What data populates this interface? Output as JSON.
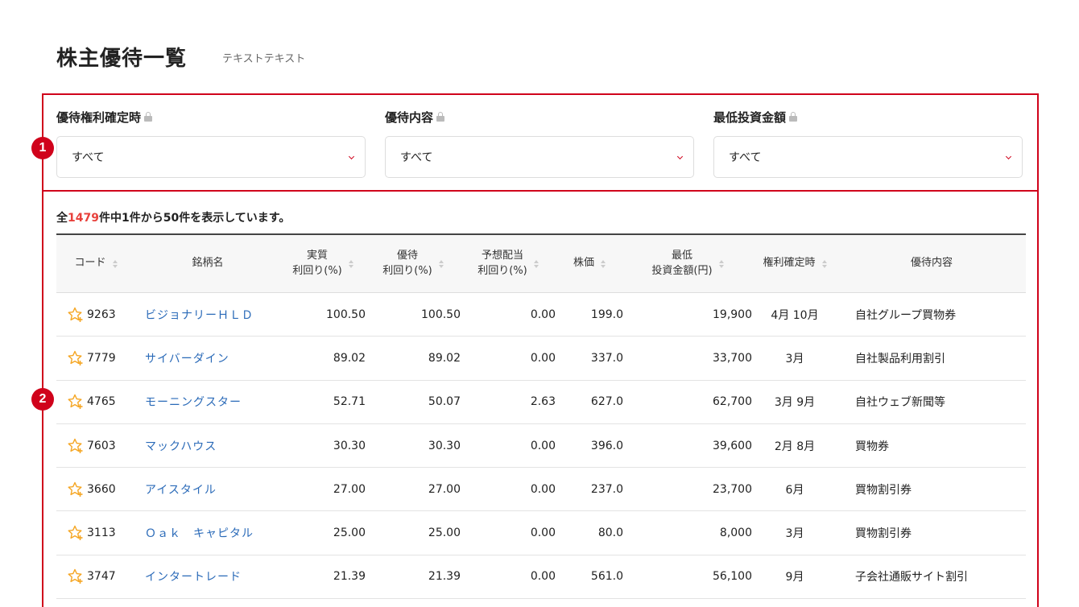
{
  "header": {
    "title": "株主優待一覧",
    "subtitle": "テキストテキスト"
  },
  "badges": [
    "1",
    "2"
  ],
  "filters": [
    {
      "label": "優待権利確定時",
      "value": "すべて"
    },
    {
      "label": "優待内容",
      "value": "すべて"
    },
    {
      "label": "最低投資金額",
      "value": "すべて"
    }
  ],
  "result": {
    "prefix": "全",
    "total": "1479",
    "suffix": "件中1件から50件を表示しています。"
  },
  "table": {
    "headers": [
      {
        "line1": "コード",
        "line2": ""
      },
      {
        "line1": "銘柄名",
        "line2": ""
      },
      {
        "line1": "実質",
        "line2": "利回り(%)"
      },
      {
        "line1": "優待",
        "line2": "利回り(%)"
      },
      {
        "line1": "予想配当",
        "line2": "利回り(%)"
      },
      {
        "line1": "株価",
        "line2": ""
      },
      {
        "line1": "最低",
        "line2": "投資金額(円)"
      },
      {
        "line1": "権利確定時",
        "line2": ""
      },
      {
        "line1": "優待内容",
        "line2": ""
      }
    ],
    "rows": [
      {
        "code": "9263",
        "name": "ビジョナリーＨＬＤ",
        "real_yield": "100.50",
        "benefit_yield": "100.50",
        "dividend_yield": "0.00",
        "price": "199.0",
        "min_invest": "19,900",
        "record_date": "4月 10月",
        "benefit": "自社グループ買物券"
      },
      {
        "code": "7779",
        "name": "サイバーダイン",
        "real_yield": "89.02",
        "benefit_yield": "89.02",
        "dividend_yield": "0.00",
        "price": "337.0",
        "min_invest": "33,700",
        "record_date": "3月",
        "benefit": "自社製品利用割引"
      },
      {
        "code": "4765",
        "name": "モーニングスター",
        "real_yield": "52.71",
        "benefit_yield": "50.07",
        "dividend_yield": "2.63",
        "price": "627.0",
        "min_invest": "62,700",
        "record_date": "3月 9月",
        "benefit": "自社ウェブ新聞等"
      },
      {
        "code": "7603",
        "name": "マックハウス",
        "real_yield": "30.30",
        "benefit_yield": "30.30",
        "dividend_yield": "0.00",
        "price": "396.0",
        "min_invest": "39,600",
        "record_date": "2月 8月",
        "benefit": "買物券"
      },
      {
        "code": "3660",
        "name": "アイスタイル",
        "real_yield": "27.00",
        "benefit_yield": "27.00",
        "dividend_yield": "0.00",
        "price": "237.0",
        "min_invest": "23,700",
        "record_date": "6月",
        "benefit": "買物割引券"
      },
      {
        "code": "3113",
        "name": "Ｏａｋ　キャピタル",
        "real_yield": "25.00",
        "benefit_yield": "25.00",
        "dividend_yield": "0.00",
        "price": "80.0",
        "min_invest": "8,000",
        "record_date": "3月",
        "benefit": "買物割引券"
      },
      {
        "code": "3747",
        "name": "インタートレード",
        "real_yield": "21.39",
        "benefit_yield": "21.39",
        "dividend_yield": "0.00",
        "price": "561.0",
        "min_invest": "56,100",
        "record_date": "9月",
        "benefit": "子会社通販サイト割引"
      }
    ]
  },
  "colors": {
    "accent": "#d0021b",
    "link": "#2a6ab8",
    "count": "#e8413c",
    "star": "#f5a623"
  }
}
